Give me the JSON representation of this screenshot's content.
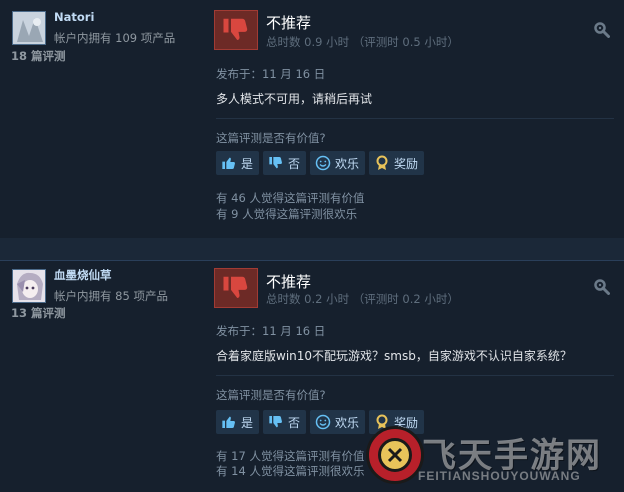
{
  "reviews": [
    {
      "username": "Natori",
      "owns": "帐户内拥有 109 项产品",
      "review_count": "18 篇评测",
      "rating": "不推荐",
      "hours": "总时数 0.9 小时 （评测时 0.5 小时）",
      "posted": "发布于：11 月 16 日",
      "content": "多人模式不可用，请稍后再试",
      "helpful_question": "这篇评测是否有价值?",
      "buttons": {
        "yes": "是",
        "no": "否",
        "funny": "欢乐",
        "award": "奖励"
      },
      "helpful_count": "有 46 人觉得这篇评测有价值",
      "funny_count": "有 9 人觉得这篇评测很欢乐"
    },
    {
      "username": "血墨烧仙草",
      "owns": "帐户内拥有 85 项产品",
      "review_count": "13 篇评测",
      "rating": "不推荐",
      "hours": "总时数 0.2 小时 （评测时 0.2 小时）",
      "posted": "发布于：11 月 16 日",
      "content": "合着家庭版win10不配玩游戏？smsb，自家游戏不认识自家系统？",
      "helpful_question": "这篇评测是否有价值?",
      "buttons": {
        "yes": "是",
        "no": "否",
        "funny": "欢乐",
        "award": "奖励"
      },
      "helpful_count": "有 17 人觉得这篇评测有价值",
      "funny_count": "有 14 人觉得这篇评测很欢乐"
    }
  ],
  "watermark": {
    "cn": "飞天手游网",
    "en": "FEITIANSHOUYOUWANG"
  },
  "colors": {
    "not_recommended": "#a13b34",
    "link": "#66c0f4",
    "background": "#1b2838",
    "panel": "#16202d"
  },
  "icons": [
    "thumbs-down-icon",
    "thumbs-up-icon",
    "smiley-icon",
    "award-icon",
    "gear-icon"
  ]
}
